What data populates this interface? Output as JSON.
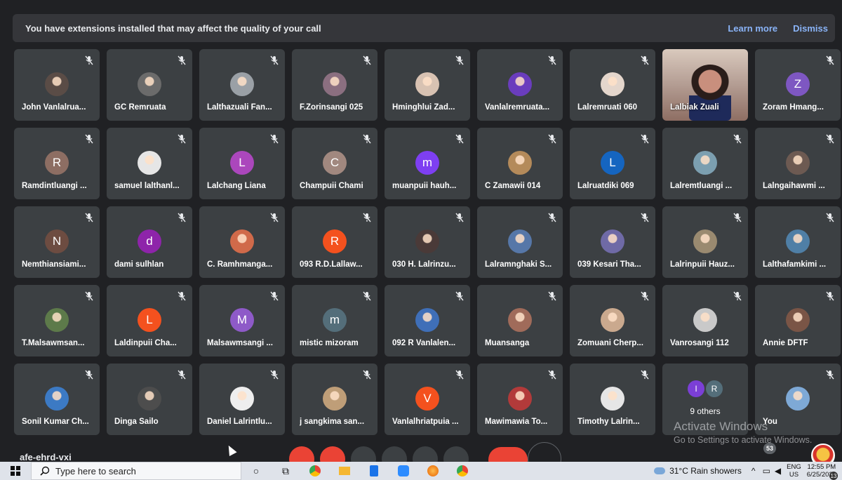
{
  "banner": {
    "message": "You have extensions installed that may affect the quality of your call",
    "learn_more": "Learn more",
    "dismiss": "Dismiss"
  },
  "participants": [
    {
      "name": "John Vanlalrua...",
      "avatar": "photo",
      "color": "#5a4c46"
    },
    {
      "name": "GC Remruata",
      "avatar": "photo",
      "color": "#6b6b6b"
    },
    {
      "name": "Lalthazuali Fan...",
      "avatar": "photo",
      "color": "#9aa0a6"
    },
    {
      "name": "F.Zorinsangi 025",
      "avatar": "photo",
      "color": "#8b6f80"
    },
    {
      "name": "Hminghlui Zad...",
      "avatar": "photo",
      "color": "#d8c2b2"
    },
    {
      "name": "Vanlalremruata...",
      "avatar": "photo",
      "color": "#6a3dbd"
    },
    {
      "name": "Lalremruati 060",
      "avatar": "photo",
      "color": "#e4d6cc"
    },
    {
      "name": "Lalbiak Zuali",
      "avatar": "video",
      "color": "#b7a197"
    },
    {
      "name": "Zoram Hmang...",
      "avatar": "letter",
      "letter": "Z",
      "color": "#7e57c2"
    },
    {
      "name": "Ramdintluangi ...",
      "avatar": "letter",
      "letter": "R",
      "color": "#8d6e63"
    },
    {
      "name": "samuel lalthanl...",
      "avatar": "photo",
      "color": "#e6e6e6"
    },
    {
      "name": "Lalchang Liana",
      "avatar": "letter",
      "letter": "L",
      "color": "#ab47bc"
    },
    {
      "name": "Champuii Chami",
      "avatar": "letter",
      "letter": "C",
      "color": "#a1887f"
    },
    {
      "name": "muanpuii hauh...",
      "avatar": "letter",
      "letter": "m",
      "color": "#7e3ff2"
    },
    {
      "name": "C Zamawii 014",
      "avatar": "photo",
      "color": "#b48a5a"
    },
    {
      "name": "Lalruatdiki 069",
      "avatar": "letter",
      "letter": "L",
      "color": "#1565c0"
    },
    {
      "name": "Lalremtluangi ...",
      "avatar": "photo",
      "color": "#7c9fb0"
    },
    {
      "name": "Lalngaihawmi ...",
      "avatar": "photo",
      "color": "#6d5a52"
    },
    {
      "name": "Nemthiansiami...",
      "avatar": "letter",
      "letter": "N",
      "color": "#6d4c41"
    },
    {
      "name": "dami sulhlan",
      "avatar": "letter",
      "letter": "d",
      "color": "#8e24aa"
    },
    {
      "name": "C. Ramhmanga...",
      "avatar": "photo",
      "color": "#d06a4a"
    },
    {
      "name": "093 R.D.Lallaw...",
      "avatar": "letter",
      "letter": "R",
      "color": "#f4511e"
    },
    {
      "name": "030 H. Lalrinzu...",
      "avatar": "photo",
      "color": "#4a3a38"
    },
    {
      "name": "Lalramnghaki S...",
      "avatar": "photo",
      "color": "#5677a8"
    },
    {
      "name": "039 Kesari Tha...",
      "avatar": "photo",
      "color": "#6f6aa6"
    },
    {
      "name": "Lalrinpuii Hauz...",
      "avatar": "photo",
      "color": "#9a8a70"
    },
    {
      "name": "Lalthafamkimi ...",
      "avatar": "photo",
      "color": "#4f7fa6"
    },
    {
      "name": "T.Malsawmsan...",
      "avatar": "photo",
      "color": "#5d7a4a"
    },
    {
      "name": "Laldinpuii Cha...",
      "avatar": "letter",
      "letter": "L",
      "color": "#f4511e"
    },
    {
      "name": "Malsawmsangi ...",
      "avatar": "letter",
      "letter": "M",
      "color": "#8e5ac8"
    },
    {
      "name": "mistic mizoram",
      "avatar": "letter",
      "letter": "m",
      "color": "#546e7a"
    },
    {
      "name": "092 R Vanlalen...",
      "avatar": "photo",
      "color": "#3f6fb8"
    },
    {
      "name": "Muansanga",
      "avatar": "photo",
      "color": "#a06b5a"
    },
    {
      "name": "Zomuani Cherp...",
      "avatar": "photo",
      "color": "#caa98e"
    },
    {
      "name": "Vanrosangi 112",
      "avatar": "photo",
      "color": "#c9c9c9"
    },
    {
      "name": "Annie DFTF",
      "avatar": "photo",
      "color": "#7a5546"
    },
    {
      "name": "Sonil Kumar Ch...",
      "avatar": "photo",
      "color": "#3c7ac4"
    },
    {
      "name": "Dinga Sailo",
      "avatar": "photo",
      "color": "#4d4d4d"
    },
    {
      "name": "Daniel Lalrintlu...",
      "avatar": "photo",
      "color": "#eeeeee"
    },
    {
      "name": "j sangkima san...",
      "avatar": "photo",
      "color": "#bf9e78"
    },
    {
      "name": "Vanlalhriatpuia ...",
      "avatar": "letter",
      "letter": "V",
      "color": "#f4511e"
    },
    {
      "name": "Mawimawia To...",
      "avatar": "photo",
      "color": "#b23a3a"
    },
    {
      "name": "Timothy Lalrin...",
      "avatar": "photo",
      "color": "#e6e6e6"
    },
    {
      "name": "9 others",
      "avatar": "others",
      "letters": [
        "I",
        "R"
      ],
      "colors": [
        "#7b3fd6",
        "#546e7a"
      ]
    },
    {
      "name": "You",
      "avatar": "photo",
      "color": "#7ea9d6"
    }
  ],
  "meeting_code": "afe-ehrd-vxi",
  "watermark": {
    "title": "Activate Windows",
    "subtitle": "Go to Settings to activate Windows."
  },
  "notification_badge": "53",
  "taskbar": {
    "search_placeholder": "Type here to search",
    "weather": "31°C  Rain showers",
    "lang_line1": "ENG",
    "lang_line2": "US",
    "time": "12:55 PM",
    "date": "6/25/2021",
    "notifications": "13"
  }
}
